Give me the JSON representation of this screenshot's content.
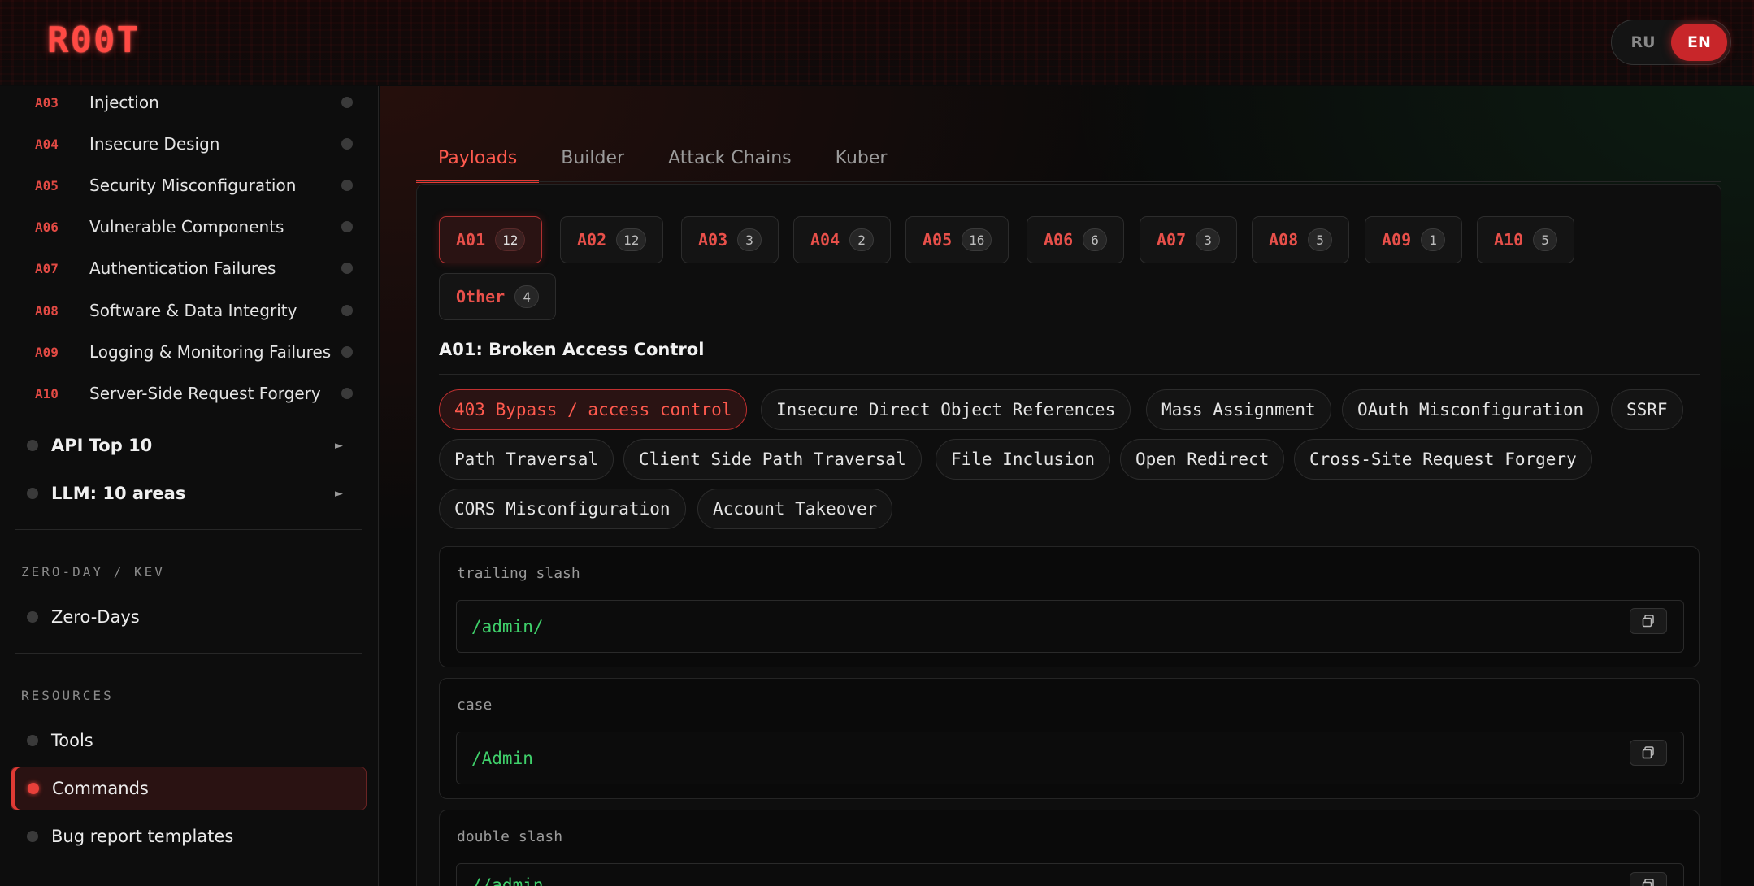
{
  "header": {
    "logo": "R00T",
    "lang": [
      {
        "label": "RU",
        "active": false
      },
      {
        "label": "EN",
        "active": true
      }
    ]
  },
  "sidebar": {
    "owasp_items": [
      {
        "code": "A03",
        "label": "Injection"
      },
      {
        "code": "A04",
        "label": "Insecure Design"
      },
      {
        "code": "A05",
        "label": "Security Misconfiguration"
      },
      {
        "code": "A06",
        "label": "Vulnerable Components"
      },
      {
        "code": "A07",
        "label": "Authentication Failures"
      },
      {
        "code": "A08",
        "label": "Software & Data Integrity"
      },
      {
        "code": "A09",
        "label": "Logging & Monitoring Failures"
      },
      {
        "code": "A10",
        "label": "Server-Side Request Forgery"
      }
    ],
    "groups": [
      {
        "label": "API Top 10",
        "arrow": "►"
      },
      {
        "label": "LLM: 10 areas",
        "arrow": "►"
      }
    ],
    "zero_day": {
      "title": "ZERO-DAY / KEV",
      "items": [
        {
          "label": "Zero-Days"
        }
      ]
    },
    "resources": {
      "title": "RESOURCES",
      "items": [
        {
          "label": "Tools",
          "active": false
        },
        {
          "label": "Commands",
          "active": true
        },
        {
          "label": "Bug report templates",
          "active": false
        }
      ]
    }
  },
  "tabs": [
    {
      "label": "Payloads",
      "active": true
    },
    {
      "label": "Builder",
      "active": false
    },
    {
      "label": "Attack Chains",
      "active": false
    },
    {
      "label": "Kuber",
      "active": false
    }
  ],
  "categories": [
    {
      "code": "A01",
      "count": "12",
      "active": true
    },
    {
      "code": "A02",
      "count": "12",
      "active": false
    },
    {
      "code": "A03",
      "count": "3",
      "active": false
    },
    {
      "code": "A04",
      "count": "2",
      "active": false
    },
    {
      "code": "A05",
      "count": "16",
      "active": false
    },
    {
      "code": "A06",
      "count": "6",
      "active": false
    },
    {
      "code": "A07",
      "count": "3",
      "active": false
    },
    {
      "code": "A08",
      "count": "5",
      "active": false
    },
    {
      "code": "A09",
      "count": "1",
      "active": false
    },
    {
      "code": "A10",
      "count": "5",
      "active": false
    },
    {
      "code": "Other",
      "count": "4",
      "active": false
    }
  ],
  "section_heading": "A01: Broken Access Control",
  "techniques": [
    {
      "label": "403 Bypass / access control",
      "active": true
    },
    {
      "label": "Insecure Direct Object References",
      "active": false
    },
    {
      "label": "Mass Assignment",
      "active": false
    },
    {
      "label": "OAuth Misconfiguration",
      "active": false
    },
    {
      "label": "SSRF",
      "active": false
    },
    {
      "label": "Path Traversal",
      "active": false
    },
    {
      "label": "Client Side Path Traversal",
      "active": false
    },
    {
      "label": "File Inclusion",
      "active": false
    },
    {
      "label": "Open Redirect",
      "active": false
    },
    {
      "label": "Cross-Site Request Forgery",
      "active": false
    },
    {
      "label": "CORS Misconfiguration",
      "active": false
    },
    {
      "label": "Account Takeover",
      "active": false
    }
  ],
  "payloads": [
    {
      "title": "trailing slash",
      "code": "/admin/"
    },
    {
      "title": "case",
      "code": "/Admin"
    },
    {
      "title": "double slash",
      "code": "//admin"
    }
  ],
  "colors": {
    "accent": "#e03a34",
    "payload_green": "#3fcf6a"
  }
}
